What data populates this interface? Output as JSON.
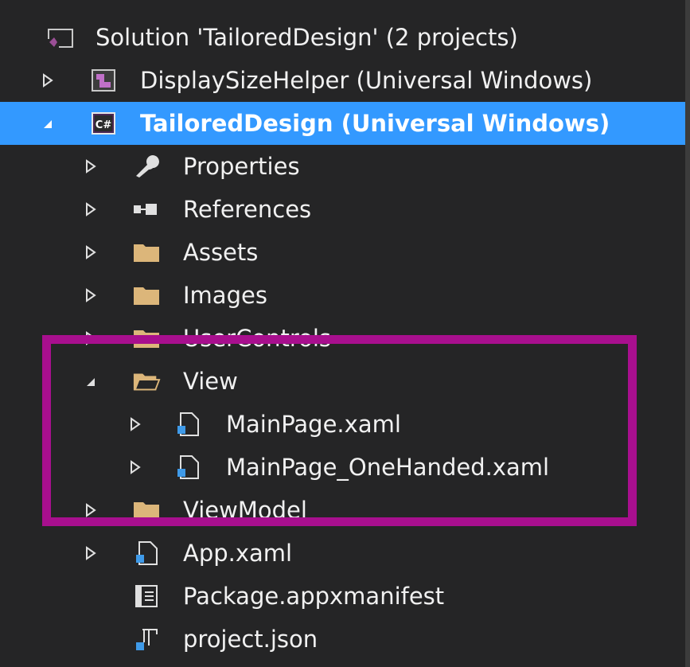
{
  "tree": {
    "solution": {
      "label": "Solution 'TailoredDesign' (2 projects)",
      "icon": "solution-icon"
    },
    "items": [
      {
        "label": "DisplaySizeHelper (Universal Windows)",
        "icon": "project-icon",
        "arrow": "collapsed",
        "selected": false
      },
      {
        "label": "TailoredDesign (Universal Windows)",
        "icon": "csharp-project-icon",
        "arrow": "expanded",
        "selected": true
      },
      {
        "label": "Properties",
        "icon": "wrench-icon",
        "arrow": "collapsed"
      },
      {
        "label": "References",
        "icon": "references-icon",
        "arrow": "collapsed"
      },
      {
        "label": "Assets",
        "icon": "folder-icon",
        "arrow": "collapsed"
      },
      {
        "label": "Images",
        "icon": "folder-icon",
        "arrow": "collapsed"
      },
      {
        "label": "UserControls",
        "icon": "folder-icon",
        "arrow": "collapsed"
      },
      {
        "label": "View",
        "icon": "folder-open-icon",
        "arrow": "expanded"
      },
      {
        "label": "MainPage.xaml",
        "icon": "xaml-file-icon",
        "arrow": "collapsed"
      },
      {
        "label": "MainPage_OneHanded.xaml",
        "icon": "xaml-file-icon",
        "arrow": "collapsed"
      },
      {
        "label": "ViewModel",
        "icon": "folder-icon",
        "arrow": "collapsed"
      },
      {
        "label": "App.xaml",
        "icon": "xaml-file-icon",
        "arrow": "collapsed"
      },
      {
        "label": "Package.appxmanifest",
        "icon": "manifest-icon",
        "arrow": "none"
      },
      {
        "label": "project.json",
        "icon": "json-file-icon",
        "arrow": "none"
      }
    ]
  },
  "colors": {
    "background": "#252526",
    "selection": "#3399ff",
    "text": "#f1f1f1",
    "highlight_border": "#a80f8e",
    "folder": "#dcb67a"
  }
}
